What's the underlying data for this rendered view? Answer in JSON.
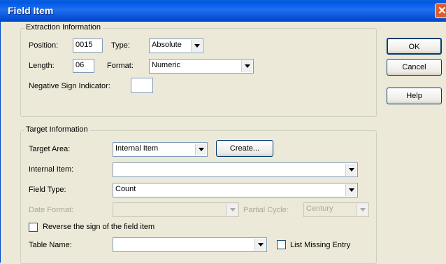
{
  "window": {
    "title": "Field Item",
    "close_glyph": "✕"
  },
  "buttons": {
    "ok": "OK",
    "cancel": "Cancel",
    "help": "Help"
  },
  "extraction": {
    "legend": "Extraction Information",
    "position_label": "Position:",
    "position_value": "0015",
    "type_label": "Type:",
    "type_value": "Absolute",
    "length_label": "Length:",
    "length_value": "06",
    "format_label": "Format:",
    "format_value": "Numeric",
    "negative_sign_label": "Negative Sign Indicator:",
    "negative_sign_value": ""
  },
  "target": {
    "legend": "Target Information",
    "target_area_label": "Target Area:",
    "target_area_value": "Internal Item",
    "create_label": "Create...",
    "internal_item_label": "Internal Item:",
    "internal_item_value": "",
    "field_type_label": "Field Type:",
    "field_type_value": "Count",
    "date_format_label": "Date Format:",
    "date_format_value": "",
    "partial_cycle_label": "Partial Cycle:",
    "partial_cycle_value": "Century",
    "reverse_sign_label": "Reverse the sign of the field item",
    "reverse_sign_checked": false,
    "table_name_label": "Table Name:",
    "table_name_value": "",
    "list_missing_label": "List Missing Entry",
    "list_missing_checked": false
  },
  "colors": {
    "titlebar": "#0058E6",
    "face": "#ECE9D8",
    "close": "#E05A2A"
  }
}
